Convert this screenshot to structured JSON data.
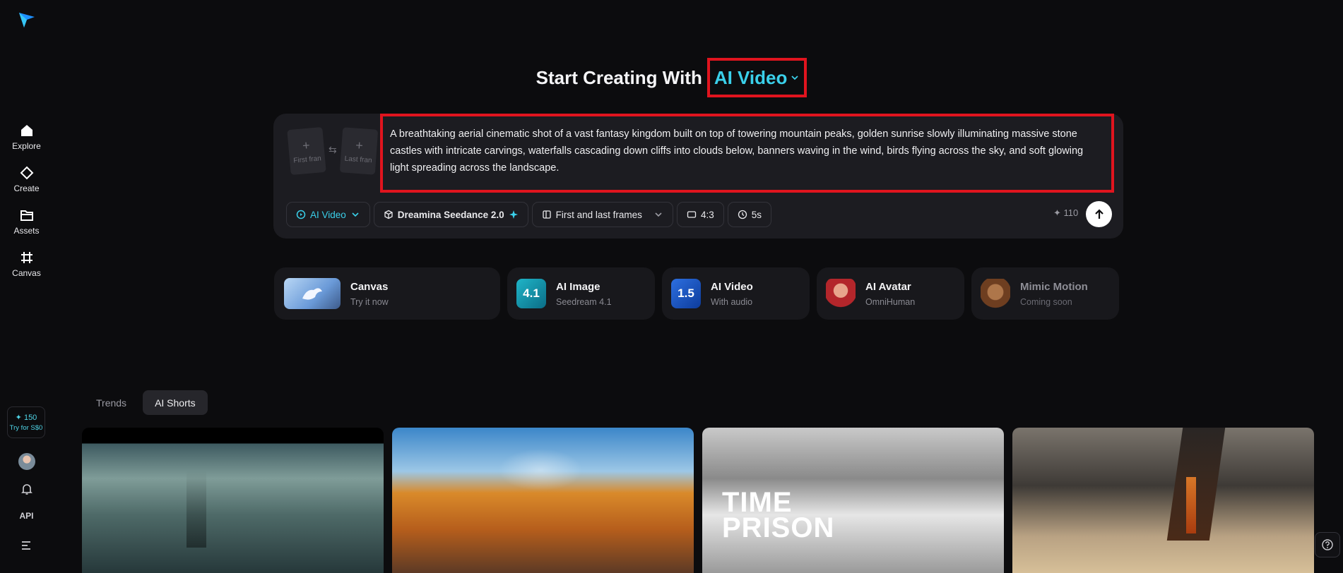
{
  "sidebar": {
    "logo_icon": "paper-plane-logo",
    "items": [
      {
        "label": "Explore",
        "icon": "home-icon"
      },
      {
        "label": "Create",
        "icon": "diamond-icon"
      },
      {
        "label": "Assets",
        "icon": "folder-icon"
      },
      {
        "label": "Canvas",
        "icon": "canvas-icon"
      }
    ],
    "credits": {
      "amount": "✦ 150",
      "try_label": "Try for S$0"
    },
    "api_label": "API"
  },
  "header": {
    "title": "Start Creating With",
    "mode": "AI Video"
  },
  "prompt": {
    "first_frame_label": "First fran",
    "last_frame_label": "Last fran",
    "text": "A breathtaking aerial cinematic shot of a vast fantasy kingdom built on top of towering mountain peaks, golden sunrise slowly illuminating massive stone castles with intricate carvings, waterfalls cascading down cliffs into clouds below, banners waving in the wind, birds flying across the sky, and soft glowing light spreading across the landscape."
  },
  "toolbar": {
    "mode": "AI Video",
    "model": "Dreamina Seedance 2.0",
    "frames": "First and last frames",
    "ratio": "4:3",
    "duration": "5s",
    "credits": "✦ 110"
  },
  "features": [
    {
      "name": "Canvas",
      "sub": "Try it now"
    },
    {
      "name": "AI Image",
      "sub": "Seedream 4.1",
      "badge": "4.1"
    },
    {
      "name": "AI Video",
      "sub": "With audio",
      "badge": "1.5"
    },
    {
      "name": "AI Avatar",
      "sub": "OmniHuman"
    },
    {
      "name": "Mimic Motion",
      "sub": "Coming soon"
    }
  ],
  "tabs": [
    {
      "label": "Trends"
    },
    {
      "label": "AI Shorts"
    }
  ],
  "gallery": {
    "card3_title_line1": "TIME",
    "card3_title_line2": "PRISON"
  },
  "colors": {
    "accent": "#3ad0ea",
    "highlight": "#e0141e"
  }
}
